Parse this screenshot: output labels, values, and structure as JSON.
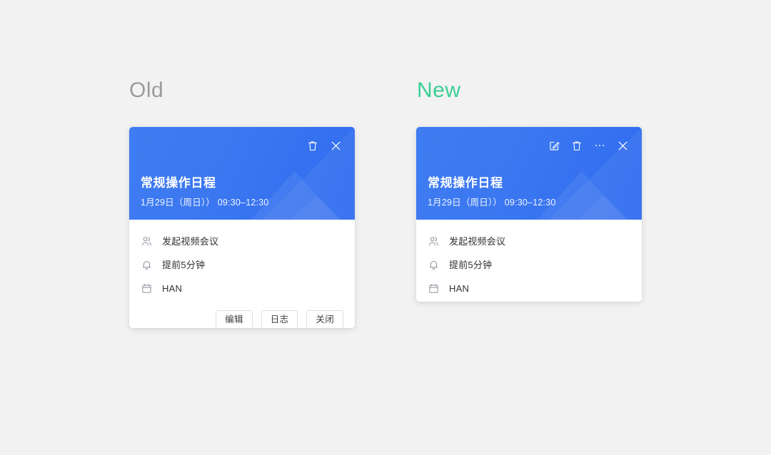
{
  "page": {
    "background_color": "#f2f2f2",
    "accent_blue": "#3b77f0",
    "accent_green": "#3ace96",
    "label_gray": "#9b9b9b"
  },
  "sections": {
    "old": {
      "label": "Old"
    },
    "new": {
      "label": "New"
    }
  },
  "card": {
    "title": "常规操作日程",
    "date": "1月29日（周日）） 09:30–12:30",
    "rows": [
      {
        "icon": "people-icon",
        "text": "发起视频会议"
      },
      {
        "icon": "bell-icon",
        "text": "提前5分钟"
      },
      {
        "icon": "calendar-icon",
        "text": "HAN"
      }
    ]
  },
  "old_card": {
    "header_actions": [
      {
        "icon": "trash-icon",
        "name": "delete"
      },
      {
        "icon": "close-icon",
        "name": "close"
      }
    ],
    "footer_buttons": [
      {
        "label": "编辑"
      },
      {
        "label": "日志"
      },
      {
        "label": "关闭"
      }
    ]
  },
  "new_card": {
    "header_actions": [
      {
        "icon": "edit-icon",
        "name": "edit"
      },
      {
        "icon": "trash-icon",
        "name": "delete"
      },
      {
        "icon": "more-icon",
        "name": "more"
      },
      {
        "icon": "close-icon",
        "name": "close"
      }
    ],
    "footer_buttons": []
  }
}
